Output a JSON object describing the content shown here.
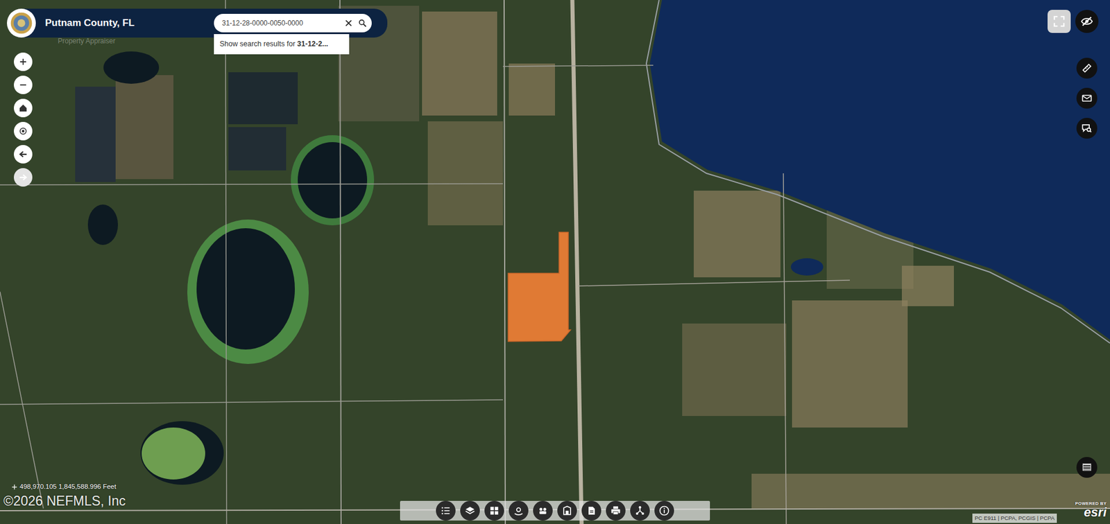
{
  "app": {
    "title": "Putnam County, FL",
    "subtitle": "Property Appraiser"
  },
  "search": {
    "value": "31-12-28-0000-0050-0000",
    "suggestion_prefix": "Show search results for",
    "suggestion_query": "31-12-2..."
  },
  "left_controls": [
    {
      "disabled": false
    },
    {
      "disabled": false
    },
    {
      "disabled": false
    },
    {
      "disabled": false
    },
    {
      "disabled": false
    },
    {
      "disabled": true
    }
  ],
  "map": {
    "parcel": {
      "selected": true
    }
  },
  "status": {
    "coordinates": "498,970.105 1,845,588.996 Feet"
  },
  "watermark": "©2026 NEFMLS, Inc",
  "attribution": "PC E911 | PCPA, PCGIS | PCPA",
  "esri": {
    "powered_by": "POWERED BY",
    "brand": "esri"
  }
}
